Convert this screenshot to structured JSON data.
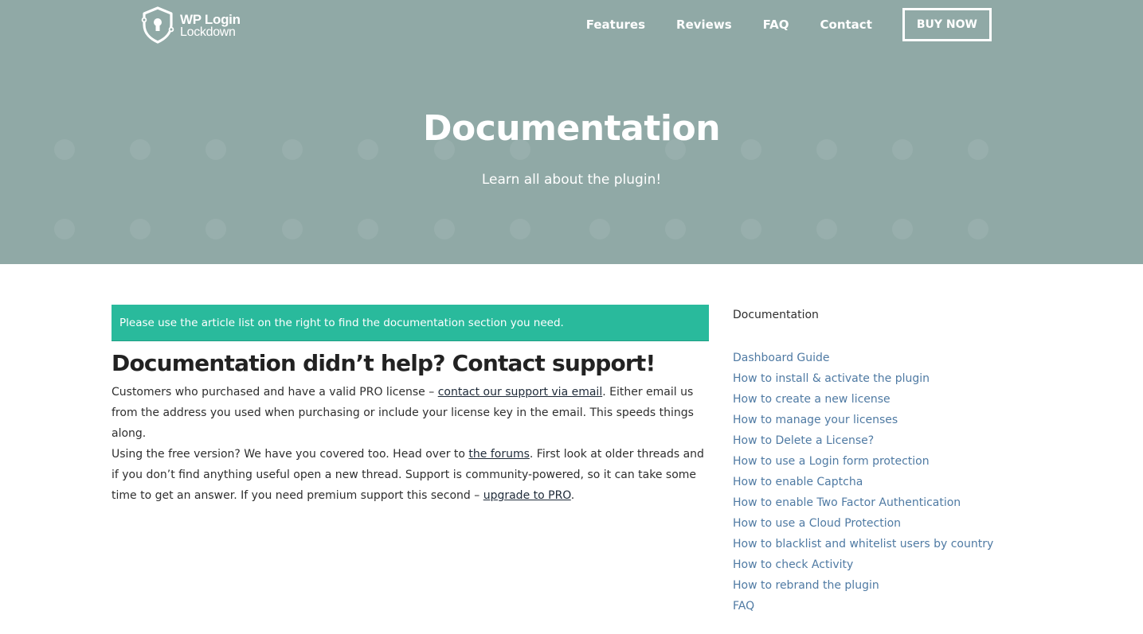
{
  "header": {
    "logo": {
      "line1": "WP Login",
      "line2": "Lockdown",
      "icon": "shield-keyhole-icon"
    },
    "nav": [
      {
        "label": "Features"
      },
      {
        "label": "Reviews"
      },
      {
        "label": "FAQ"
      },
      {
        "label": "Contact"
      }
    ],
    "buy_label": "BUY NOW"
  },
  "hero": {
    "title": "Documentation",
    "subtitle": "Learn all about the plugin!",
    "background_color": "#90a9a6"
  },
  "notice": {
    "text": "Please use the article list on the right to find the documentation section you need.",
    "color": "#29ba9c"
  },
  "content": {
    "heading": "Documentation didn’t help? Contact support!",
    "p1_before": "Customers who purchased and have a valid PRO license – ",
    "p1_link": "contact our support via email",
    "p1_after": ". Either email us from the address you used when purchasing or include your license key in the email. This speeds things along.",
    "p2_before": "Using the free version? We have you covered too. Head over to ",
    "p2_link": "the forums",
    "p2_middle": ". First look at older threads and if you don’t find anything useful open a new thread. Support is community-powered, so it can take some time to get an answer. If you need premium support this second – ",
    "p2_link2": "upgrade to PRO",
    "p2_end": "."
  },
  "sidebar": {
    "title": "Documentation",
    "link_color": "#4f7aa3",
    "items": [
      {
        "label": "Dashboard Guide"
      },
      {
        "label": "How to install & activate the plugin"
      },
      {
        "label": "How to create a new license"
      },
      {
        "label": "How to manage your licenses"
      },
      {
        "label": "How to Delete a License?"
      },
      {
        "label": "How to use a Login form protection"
      },
      {
        "label": "How to enable Captcha"
      },
      {
        "label": "How to enable Two Factor Authentication"
      },
      {
        "label": "How to use a Cloud Protection"
      },
      {
        "label": "How to blacklist and whitelist users by country"
      },
      {
        "label": "How to check Activity"
      },
      {
        "label": "How to rebrand the plugin"
      },
      {
        "label": "FAQ"
      }
    ]
  }
}
